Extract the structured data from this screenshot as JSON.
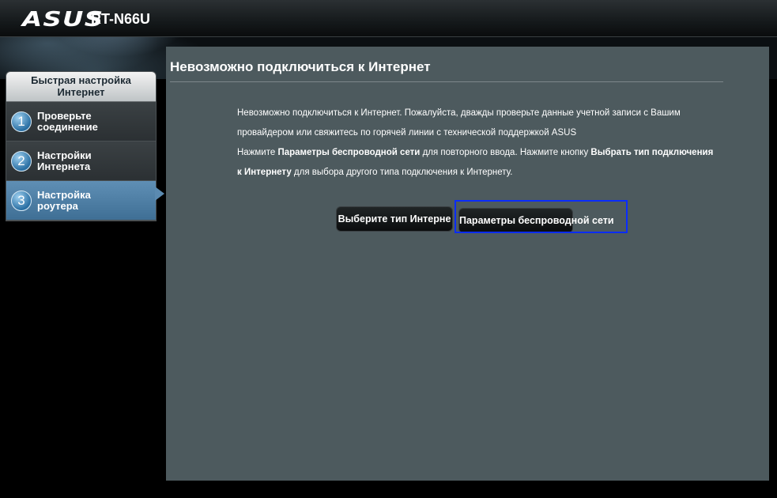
{
  "header": {
    "logo": "ASUS",
    "model": "RT-N66U"
  },
  "sidebar": {
    "title": "Быстрая настройка Интернет",
    "steps": [
      {
        "num": "1",
        "label_line1": "Проверьте",
        "label_line2": "соединение",
        "active": false
      },
      {
        "num": "2",
        "label_line1": "Настройки",
        "label_line2": "Интернета",
        "active": false
      },
      {
        "num": "3",
        "label_line1": "Настройка",
        "label_line2": "роутера",
        "active": true
      }
    ]
  },
  "main": {
    "title": "Невозможно подключиться к Интернет",
    "line1": "Невозможно подключиться к Интернет. Пожалуйста, дважды проверьте данные учетной записи с Вашим",
    "line2": "провайдером или свяжитесь по горячей линии с технической поддержкой ASUS",
    "line3_prefix": "Нажмите ",
    "line3_bold": "Параметры беспроводной сети",
    "line3_suffix": " для повторного ввода. Нажмите кнопку ",
    "line3_bold2": "Выбрать тип подключения",
    "line4_bold": "к Интернету",
    "line4_suffix": " для выбора другого типа подключения к Интернету.",
    "buttons": {
      "select_type": "Выберите тип Интерне",
      "wireless_params": "Параметры беспроводной сети"
    }
  },
  "colors": {
    "panel": "#4d5a5e",
    "active_step": "#4f7fa5",
    "focus_ring": "#0a2cff"
  }
}
